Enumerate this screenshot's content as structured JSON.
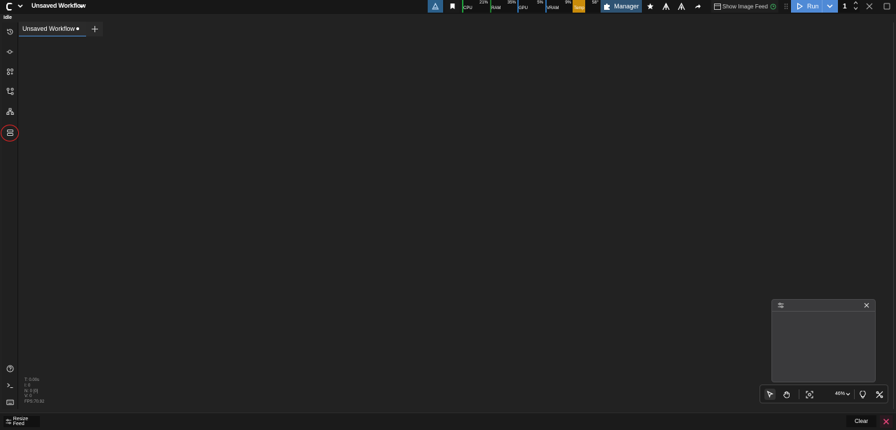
{
  "topbar": {
    "workflow_name": "Unsaved Workflow",
    "monitors": [
      {
        "label": "CPU",
        "value": "21%",
        "color": "#1f9e3a",
        "level": 0.21
      },
      {
        "label": "RAM",
        "value": "35%",
        "color": "#1f7a2e",
        "level": 0.35
      },
      {
        "label": "GPU",
        "value": "5%",
        "color": "#2a6fb0",
        "level": 0.05
      },
      {
        "label": "VRAM",
        "value": "9%",
        "color": "#2a6fb0",
        "level": 0.09
      },
      {
        "label": "Temp",
        "value": "58°",
        "color": "#c98b0a",
        "level": 0.58
      }
    ],
    "manager_label": "Manager",
    "show_feed_label": "Show Image Feed",
    "run_label": "Run",
    "run_count": "1"
  },
  "status": {
    "text": "Idle"
  },
  "tabs": [
    {
      "label": "Unsaved Workflow"
    }
  ],
  "stats": {
    "t": "T: 0.00s",
    "i": "I: 0",
    "n": "N: 0 [0]",
    "v": "V: 0",
    "fps": "FPS:70.92"
  },
  "canvas_toolbar": {
    "zoom": "46%"
  },
  "bottombar": {
    "resize_label": "Resize Feed",
    "clear_label": "Clear"
  },
  "colors": {
    "accent": "#4f8ad6",
    "highlight_ring": "#e02424"
  },
  "icons": [
    "comfy-logo-icon",
    "chevron-down-icon",
    "bookmark-icon",
    "puzzle-icon",
    "star-icon",
    "history-icon",
    "node-library-icon",
    "model-library-icon",
    "workflows-icon",
    "templates-icon",
    "queue-icon",
    "help-icon",
    "terminal-icon",
    "keyboard-icon",
    "play-icon",
    "close-icon",
    "maximize-icon",
    "plus-icon",
    "settings-icon",
    "pointer-icon",
    "hand-icon",
    "fit-view-icon",
    "lightbulb-icon",
    "link-visibility-icon"
  ]
}
